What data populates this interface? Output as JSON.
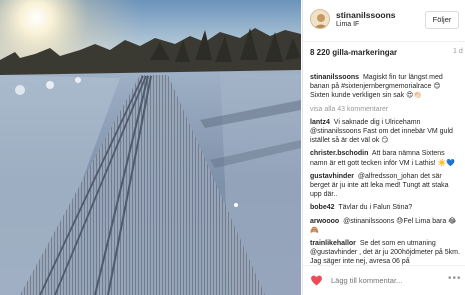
{
  "post": {
    "username": "stinanilssoons",
    "location": "Lima IF",
    "follow_label": "Följer",
    "likes": "8 220 gilla-markeringar",
    "time_ago": "1 d"
  },
  "comments": [
    {
      "user": "stinanilssoons",
      "text": "Magiskt fin tur längst med banan på #sixtenjernbergmemorialrace 😊 Sixten kunde verkligen sin sak 😍👏🏻"
    },
    {
      "user": "lantz4",
      "text": "Vi saknade dig i Ulricehamn @stinanilssoons   Fast om det innebär VM guld istället så är det väl ok 😏"
    },
    {
      "user": "christer.bschodin",
      "text": "Att bara nämna Sixtens namn är ett gott tecken inför VM i Lathis! ☀️💙"
    },
    {
      "user": "gustavhinder",
      "text": "@alfredsson_johan det sär berget är ju inte att leka med! Tungt att staka upp där.."
    },
    {
      "user": "bobe42",
      "text": "Tävlar du i Falun Stina?"
    },
    {
      "user": "arwoooo",
      "text": "@stinanilssoons 😓Fel Lima bara 😂🙈"
    },
    {
      "user": "trainlikehallor",
      "text": "Se det som en utmaning @gustavhinder , det är ju 200höjdmeter på 5km. Jag säger inte nej, avresa 06 på"
    }
  ],
  "view_all": "visa alla 43 kommentarer",
  "add_comment_placeholder": "Lägg till kommentar...",
  "more_icon": "•••",
  "colors": {
    "link": "#003569",
    "muted": "#999999",
    "border": "#e6e6e6"
  },
  "icons": {
    "heart": "heart-icon",
    "more": "more-options-icon"
  }
}
